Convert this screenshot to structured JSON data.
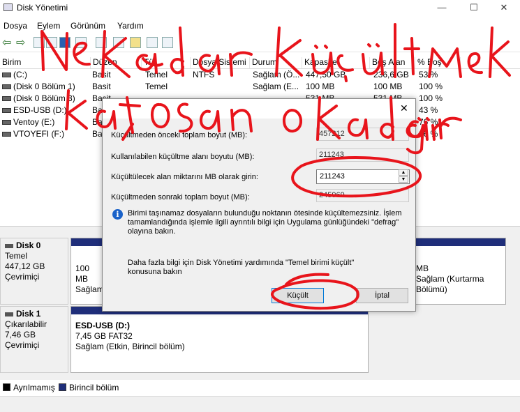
{
  "window": {
    "title": "Disk Yönetimi",
    "controls": {
      "minimize": "—",
      "maximize": "☐",
      "close": "✕"
    }
  },
  "menu": [
    "Dosya",
    "Eylem",
    "Görünüm",
    "Yardım"
  ],
  "list": {
    "columns": [
      "Birim",
      "Düzen",
      "Tür",
      "Dosya Sistemi",
      "Durum",
      "Kapasite",
      "Boş Alan",
      "% Boş"
    ],
    "rows": [
      [
        "(C:)",
        "Basit",
        "Temel",
        "NTFS",
        "Sağlam (Ö...",
        "447,50 GB",
        "236,6 GB",
        "53 %"
      ],
      [
        "(Disk 0 Bölüm 1)",
        "Basit",
        "Temel",
        "",
        "Sağlam (E...",
        "100 MB",
        "100 MB",
        "100 %"
      ],
      [
        "(Disk 0 Bölüm 3)",
        "Basit",
        "",
        "",
        "",
        "531 MB",
        "531 MB",
        "100 %"
      ],
      [
        "ESD-USB (D:)",
        "Basit",
        "",
        "",
        "",
        "",
        "",
        "43 %"
      ],
      [
        "Ventoy (E:)",
        "Basit",
        "",
        "",
        "",
        "",
        "",
        "76 %"
      ],
      [
        "VTOYEFI (F:)",
        "Basit",
        "",
        "",
        "",
        "",
        "",
        "96 %"
      ]
    ]
  },
  "disks": [
    {
      "name": "Disk 0",
      "type": "Temel",
      "size": "447,12 GB",
      "status": "Çevrimiçi",
      "left_part": {
        "line1": "100 MB",
        "line2": "Sağlam"
      },
      "right_part": {
        "line1": "MB",
        "line2": "Sağlam (Kurtarma Bölümü)"
      }
    },
    {
      "name": "Disk 1",
      "type": "Çıkarılabilir",
      "size": "7,46 GB",
      "status": "Çevrimiçi",
      "part": {
        "name": "ESD-USB  (D:)",
        "line1": "7,45 GB FAT32",
        "line2": "Sağlam (Etkin, Birincil bölüm)"
      }
    }
  ],
  "legend": [
    "Ayrılmamış",
    "Birincil bölüm"
  ],
  "legend_colors": {
    "unallocated": "#000000",
    "primary": "#1f2e7a"
  },
  "dialog": {
    "close": "✕",
    "fields": [
      {
        "label": "Küçültmeden önceki toplam boyut (MB):",
        "value": "457212"
      },
      {
        "label": "Kullanılabilen küçültme alanı boyutu (MB):",
        "value": "211243"
      },
      {
        "label": "Küçültülecek alan miktarını MB olarak girin:",
        "value": "211243"
      },
      {
        "label": "Küçültmeden sonraki toplam boyut (MB):",
        "value": "245969"
      }
    ],
    "info": "Birimi taşınamaz dosyaların bulunduğu noktanın ötesinde küçültemezsiniz. İşlem tamamlandığında işlemle ilgili ayrıntılı bilgi için Uygulama günlüğündeki \"defrag\" olayına bakın.",
    "help": "Daha fazla bilgi için Disk Yönetimi yardımında \"Temel birimi küçült\" konusuna bakın",
    "ok": "Küçült",
    "cancel": "İptal"
  },
  "annotation_color": "#e8141b"
}
